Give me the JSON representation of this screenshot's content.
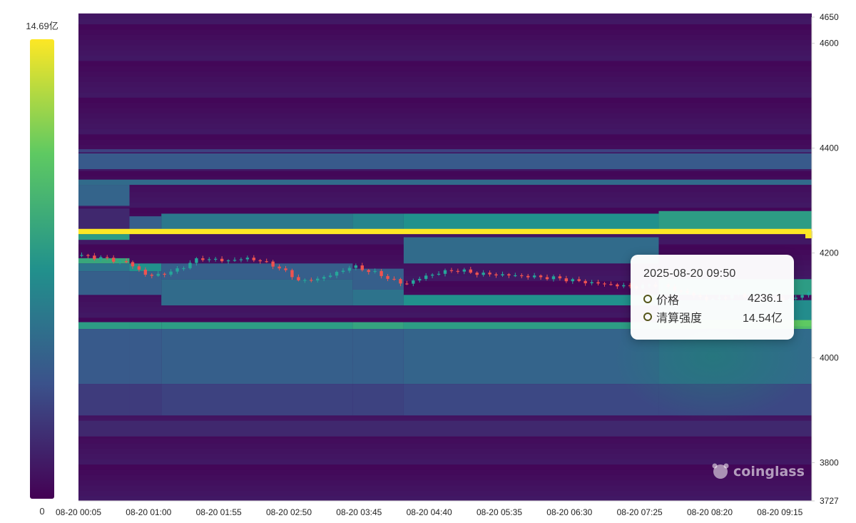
{
  "colors": {
    "scale": [
      "#440154",
      "#3b528b",
      "#21918c",
      "#5ec962",
      "#fde725"
    ],
    "candle_up": "#26a69a",
    "candle_down": "#ef5350"
  },
  "colorbar": {
    "max_label": "14.69亿",
    "min_label": "0"
  },
  "tooltip": {
    "time": "2025-08-20 09:50",
    "rows": [
      {
        "label": "价格",
        "value": "4236.1"
      },
      {
        "label": "清算强度",
        "value": "14.54亿"
      }
    ]
  },
  "watermark": {
    "text": "coinglass",
    "icon": "coinglass-logo-icon"
  },
  "chart_data": {
    "type": "heatmap",
    "title": "",
    "xlabel": "",
    "ylabel": "",
    "ylim": [
      3727,
      4650
    ],
    "value_range": [
      0,
      14.69
    ],
    "value_unit": "亿",
    "y_ticks": [
      4650,
      4600,
      4400,
      4200,
      4000,
      3800,
      3727
    ],
    "x_ticks": [
      "08-20 00:05",
      "08-20 01:00",
      "08-20 01:55",
      "08-20 02:50",
      "08-20 03:45",
      "08-20 04:40",
      "08-20 05:35",
      "08-20 06:30",
      "08-20 07:25",
      "08-20 08:20",
      "08-20 09:15"
    ],
    "x_tick_minutes": [
      5,
      60,
      115,
      170,
      225,
      280,
      335,
      390,
      445,
      500,
      555
    ],
    "x_range_minutes": [
      5,
      580
    ],
    "segments": [
      {
        "start": 5,
        "end": 45,
        "bands": [
          [
            4225,
            4236,
            0.55
          ],
          [
            4180,
            4190,
            0.6
          ],
          [
            4165,
            4180,
            0.38
          ],
          [
            4120,
            4165,
            0.3
          ],
          [
            4240,
            4285,
            0.12
          ],
          [
            4290,
            4330,
            0.32
          ],
          [
            4055,
            4068,
            0.55
          ],
          [
            3950,
            4055,
            0.28
          ],
          [
            3890,
            3950,
            0.18
          ]
        ]
      },
      {
        "start": 45,
        "end": 70,
        "bands": [
          [
            4240,
            4270,
            0.3
          ],
          [
            4165,
            4180,
            0.5
          ],
          [
            4120,
            4165,
            0.3
          ],
          [
            4055,
            4068,
            0.55
          ],
          [
            3950,
            4055,
            0.28
          ],
          [
            3890,
            3950,
            0.18
          ]
        ]
      },
      {
        "start": 70,
        "end": 220,
        "bands": [
          [
            4240,
            4275,
            0.4
          ],
          [
            4150,
            4180,
            0.3
          ],
          [
            4100,
            4150,
            0.35
          ],
          [
            4055,
            4068,
            0.55
          ],
          [
            3950,
            4055,
            0.3
          ],
          [
            3890,
            3950,
            0.2
          ]
        ]
      },
      {
        "start": 220,
        "end": 260,
        "bands": [
          [
            4240,
            4275,
            0.45
          ],
          [
            4130,
            4170,
            0.3
          ],
          [
            4100,
            4130,
            0.38
          ],
          [
            4055,
            4068,
            0.58
          ],
          [
            3950,
            4055,
            0.3
          ],
          [
            3890,
            3950,
            0.2
          ]
        ]
      },
      {
        "start": 260,
        "end": 460,
        "bands": [
          [
            4240,
            4275,
            0.5
          ],
          [
            4180,
            4230,
            0.35
          ],
          [
            4100,
            4120,
            0.5
          ],
          [
            4055,
            4068,
            0.55
          ],
          [
            3950,
            4055,
            0.32
          ],
          [
            3890,
            3950,
            0.22
          ]
        ]
      },
      {
        "start": 460,
        "end": 580,
        "bands": [
          [
            4240,
            4280,
            0.55
          ],
          [
            4120,
            4150,
            0.55
          ],
          [
            4068,
            4110,
            0.48
          ],
          [
            4055,
            4068,
            0.7
          ],
          [
            4060,
            4072,
            0.75
          ],
          [
            3950,
            4055,
            0.35
          ],
          [
            3890,
            3950,
            0.22
          ]
        ]
      }
    ],
    "global_bands": [
      [
        4330,
        4340,
        0.35
      ],
      [
        4360,
        4390,
        0.28
      ],
      [
        4392,
        4398,
        0.2
      ],
      [
        4236,
        4246,
        1.0
      ],
      [
        3850,
        3880,
        0.12
      ]
    ],
    "price_series": {
      "x_minutes": [
        5,
        25,
        45,
        60,
        80,
        100,
        120,
        140,
        160,
        180,
        200,
        220,
        240,
        260,
        280,
        300,
        320,
        340,
        360,
        380,
        400,
        420,
        440,
        460,
        480,
        500,
        520,
        540,
        560,
        580
      ],
      "close": [
        4195,
        4190,
        4180,
        4155,
        4165,
        4190,
        4185,
        4190,
        4175,
        4145,
        4155,
        4175,
        4160,
        4140,
        4158,
        4168,
        4160,
        4158,
        4155,
        4152,
        4145,
        4140,
        4135,
        4140,
        4125,
        4110,
        4120,
        4118,
        4110,
        4125
      ]
    }
  }
}
